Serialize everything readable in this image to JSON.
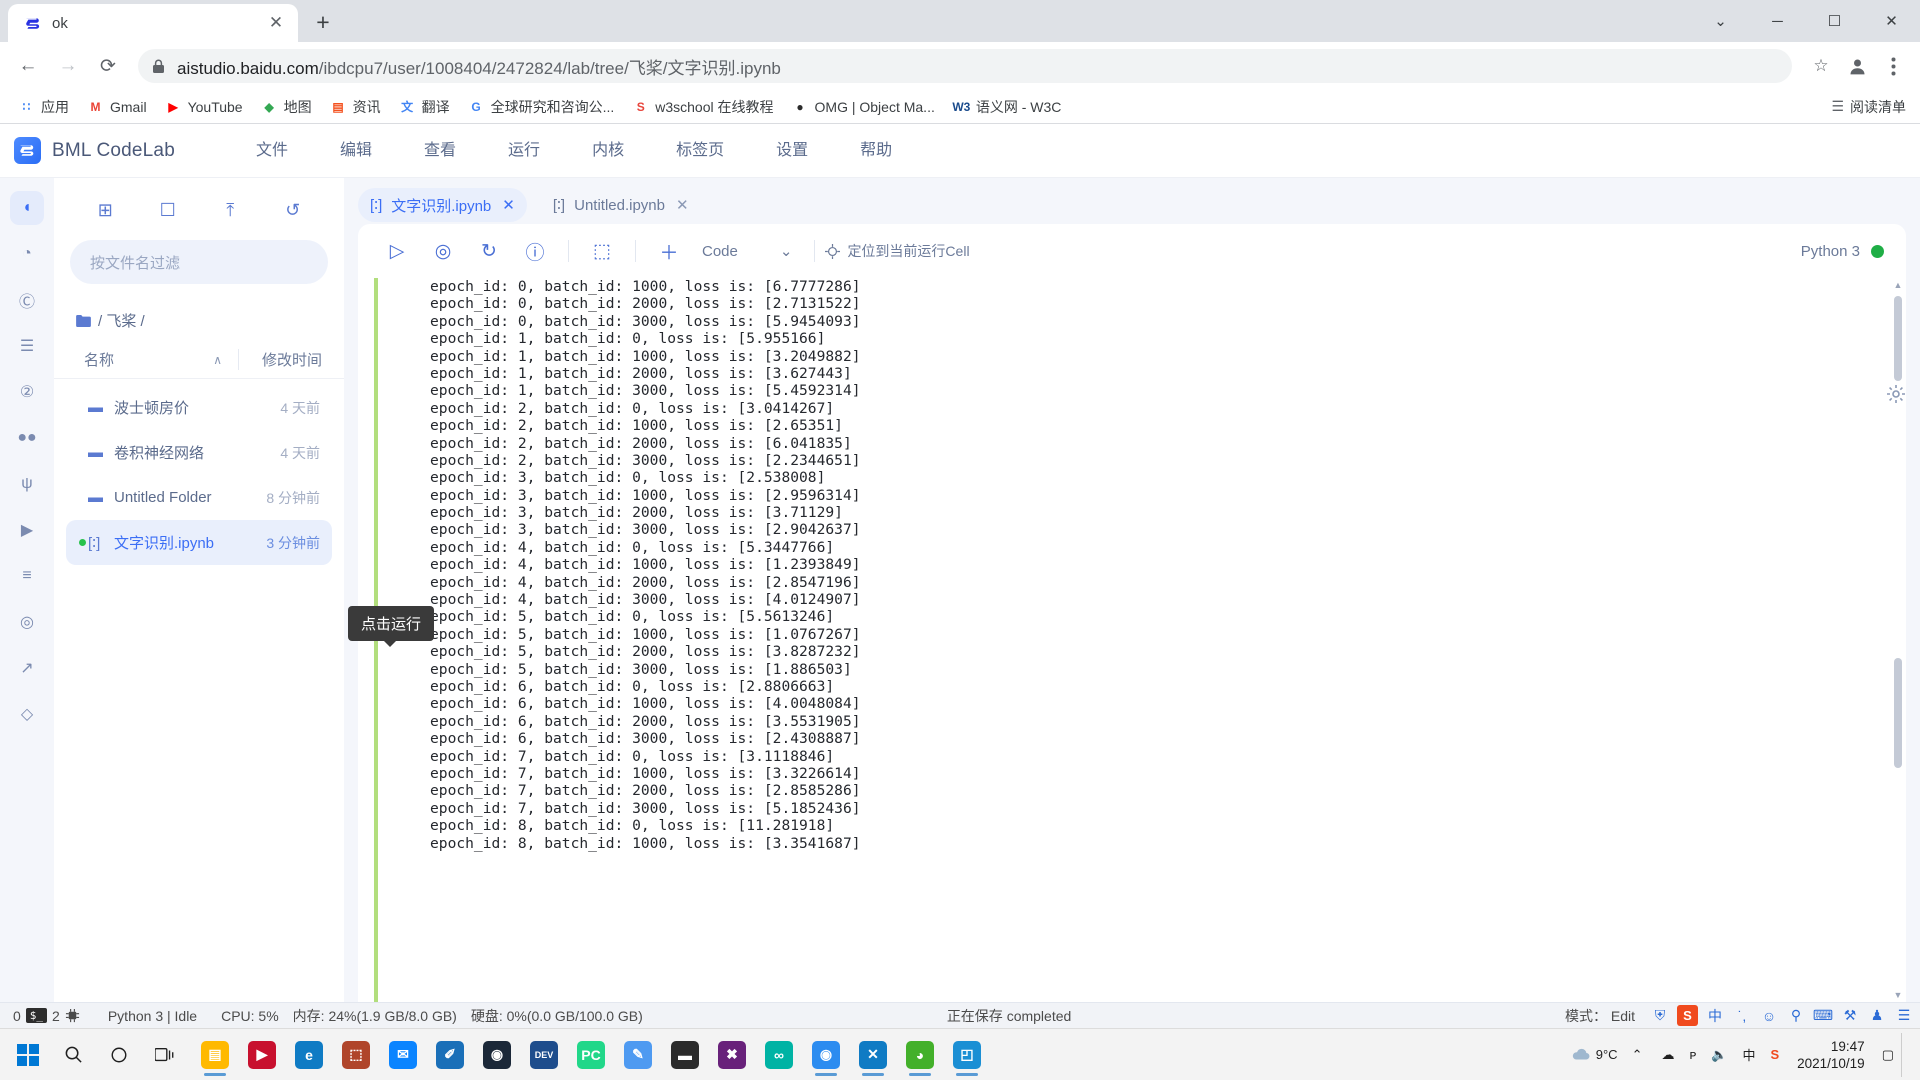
{
  "browser": {
    "tab": {
      "title": "ok",
      "favicon_name": "aistudio-favicon"
    },
    "newtab_label": "+",
    "window_controls": {
      "minimize": "─",
      "maximize": "☐",
      "close": "✕",
      "chevron": "⌄"
    },
    "nav": {
      "back": "←",
      "forward": "→",
      "reload": "⟳"
    },
    "omnibox": {
      "lock_icon": "lock-icon",
      "url_domain": "aistudio.baidu.com",
      "url_path": "/ibdcpu7/user/1008404/2472824/lab/tree/飞桨/文字识别.ipynb",
      "star": "☆"
    },
    "bookmarks": [
      {
        "label": "应用",
        "icon": "apps-grid-icon",
        "color": "#4285f4",
        "glyph": "∷"
      },
      {
        "label": "Gmail",
        "icon": "gmail-icon",
        "color": "#ea4335",
        "glyph": "M"
      },
      {
        "label": "YouTube",
        "icon": "youtube-icon",
        "color": "#ff0000",
        "glyph": "▶"
      },
      {
        "label": "地图",
        "icon": "google-maps-icon",
        "color": "#34a853",
        "glyph": "◆"
      },
      {
        "label": "资讯",
        "icon": "google-news-icon",
        "color": "#f4511e",
        "glyph": "▤"
      },
      {
        "label": "翻译",
        "icon": "google-translate-icon",
        "color": "#4285f4",
        "glyph": "文"
      },
      {
        "label": "全球研究和咨询公...",
        "icon": "google-g-icon",
        "color": "#4285f4",
        "glyph": "G"
      },
      {
        "label": "w3school 在线教程",
        "icon": "w3school-icon",
        "color": "#e8453c",
        "glyph": "S"
      },
      {
        "label": "OMG | Object Ma...",
        "icon": "omg-icon",
        "color": "#2b2b2b",
        "glyph": "●"
      },
      {
        "label": "语义网 - W3C",
        "icon": "w3c-icon",
        "color": "#1a4b8c",
        "glyph": "W3"
      }
    ],
    "reading_list": "阅读清单",
    "reading_list_icon": "reading-list-icon",
    "profile_icon": "profile-avatar-icon",
    "menu_icon": "chrome-menu-icon"
  },
  "bml": {
    "brand": "BML CodeLab",
    "logo_glyph": "ə",
    "menu": [
      "文件",
      "编辑",
      "查看",
      "运行",
      "内核",
      "标签页",
      "设置",
      "帮助"
    ]
  },
  "rail": [
    {
      "name": "files",
      "glyph": "◖",
      "active": true
    },
    {
      "name": "running",
      "glyph": "◔",
      "active": false
    },
    {
      "name": "commands",
      "glyph": "Ⓒ",
      "active": false
    },
    {
      "name": "properties",
      "glyph": "☰",
      "active": false
    },
    {
      "name": "datasets",
      "glyph": "②",
      "active": false
    },
    {
      "name": "extensions",
      "glyph": "●●",
      "active": false
    },
    {
      "name": "git",
      "glyph": "ψ",
      "active": false
    },
    {
      "name": "player",
      "glyph": "▶",
      "active": false
    },
    {
      "name": "notes",
      "glyph": "≡",
      "active": false
    },
    {
      "name": "target",
      "glyph": "◎",
      "active": false
    },
    {
      "name": "analytics",
      "glyph": "↗",
      "active": false
    },
    {
      "name": "diamond",
      "glyph": "◇",
      "active": false
    }
  ],
  "filebrowser": {
    "toolbar": [
      {
        "name": "new-launcher",
        "glyph": "⊞"
      },
      {
        "name": "new-folder",
        "glyph": "☐"
      },
      {
        "name": "upload",
        "glyph": "⤒"
      },
      {
        "name": "refresh",
        "glyph": "↺"
      }
    ],
    "filter_placeholder": "按文件名过滤",
    "breadcrumb": "/ 飞桨 /",
    "breadcrumb_icon": "folder-icon",
    "col_name": "名称",
    "col_modified": "修改时间",
    "sort_arrow": "∧",
    "items": [
      {
        "name": "波士顿房价",
        "time": "4 天前",
        "type": "folder",
        "selected": false,
        "running": false
      },
      {
        "name": "卷积神经网络",
        "time": "4 天前",
        "type": "folder",
        "selected": false,
        "running": false
      },
      {
        "name": "Untitled Folder",
        "time": "8 分钟前",
        "type": "folder",
        "selected": false,
        "running": false
      },
      {
        "name": "文字识别.ipynb",
        "time": "3 分钟前",
        "type": "notebook",
        "selected": true,
        "running": true
      }
    ]
  },
  "notebook": {
    "tabs": [
      {
        "label": "文字识别.ipynb",
        "active": true,
        "close": "✕",
        "icon": "notebook-icon"
      },
      {
        "label": "Untitled.ipynb",
        "active": false,
        "close": "✕",
        "icon": "notebook-icon"
      }
    ],
    "toolbar": {
      "run": {
        "name": "run-cell-button",
        "glyph": "▷"
      },
      "run_all": {
        "name": "run-all-button",
        "glyph": "◎"
      },
      "restart": {
        "name": "restart-kernel-button",
        "glyph": "↻"
      },
      "interrupt": {
        "name": "interrupt-kernel-button",
        "glyph": "ⓘ"
      },
      "save": {
        "name": "save-notebook-button",
        "glyph": "⬚"
      },
      "add": {
        "name": "add-cell-button",
        "glyph": "＋"
      },
      "celltype_value": "Code",
      "celltype_caret": "⌄",
      "locate_label": "定位到当前运行Cell",
      "locate_icon": "crosshair-icon",
      "kernel_label": "Python 3",
      "kernel_status": "idle-dot"
    },
    "tooltip": "点击运行",
    "settings_icon": "settings-gear-icon",
    "output_lines": [
      "epoch_id: 0, batch_id: 1000, loss is: [6.7777286]",
      "epoch_id: 0, batch_id: 2000, loss is: [2.7131522]",
      "epoch_id: 0, batch_id: 3000, loss is: [5.9454093]",
      "epoch_id: 1, batch_id: 0, loss is: [5.955166]",
      "epoch_id: 1, batch_id: 1000, loss is: [3.2049882]",
      "epoch_id: 1, batch_id: 2000, loss is: [3.627443]",
      "epoch_id: 1, batch_id: 3000, loss is: [5.4592314]",
      "epoch_id: 2, batch_id: 0, loss is: [3.0414267]",
      "epoch_id: 2, batch_id: 1000, loss is: [2.65351]",
      "epoch_id: 2, batch_id: 2000, loss is: [6.041835]",
      "epoch_id: 2, batch_id: 3000, loss is: [2.2344651]",
      "epoch_id: 3, batch_id: 0, loss is: [2.538008]",
      "epoch_id: 3, batch_id: 1000, loss is: [2.9596314]",
      "epoch_id: 3, batch_id: 2000, loss is: [3.71129]",
      "epoch_id: 3, batch_id: 3000, loss is: [2.9042637]",
      "epoch_id: 4, batch_id: 0, loss is: [5.3447766]",
      "epoch_id: 4, batch_id: 1000, loss is: [1.2393849]",
      "epoch_id: 4, batch_id: 2000, loss is: [2.8547196]",
      "epoch_id: 4, batch_id: 3000, loss is: [4.0124907]",
      "epoch_id: 5, batch_id: 0, loss is: [5.5613246]",
      "epoch_id: 5, batch_id: 1000, loss is: [1.0767267]",
      "epoch_id: 5, batch_id: 2000, loss is: [3.8287232]",
      "epoch_id: 5, batch_id: 3000, loss is: [1.886503]",
      "epoch_id: 6, batch_id: 0, loss is: [2.8806663]",
      "epoch_id: 6, batch_id: 1000, loss is: [4.0048084]",
      "epoch_id: 6, batch_id: 2000, loss is: [3.5531905]",
      "epoch_id: 6, batch_id: 3000, loss is: [2.4308887]",
      "epoch_id: 7, batch_id: 0, loss is: [3.1118846]",
      "epoch_id: 7, batch_id: 1000, loss is: [3.3226614]",
      "epoch_id: 7, batch_id: 2000, loss is: [2.8585286]",
      "epoch_id: 7, batch_id: 3000, loss is: [5.1852436]",
      "epoch_id: 8, batch_id: 0, loss is: [11.281918]",
      "epoch_id: 8, batch_id: 1000, loss is: [3.3541687]"
    ]
  },
  "statusbar": {
    "terminals_count": "0",
    "terminal_icon": "terminal-icon",
    "kernels_count": "2",
    "cpu_icon": "cpu-chip-icon",
    "kernel_state": "Python 3 | Idle",
    "cpu": "CPU: 5%",
    "memory": "内存: 24%(1.9 GB/8.0 GB)",
    "disk": "硬盘: 0%(0.0 GB/100.0 GB)",
    "save_state": "正在保存 completed",
    "mode": "模式： Edit",
    "ime": [
      {
        "name": "shield-icon",
        "glyph": "⛨"
      },
      {
        "name": "sogou-logo-icon",
        "glyph": "S"
      },
      {
        "name": "chinese-mode-icon",
        "glyph": "中"
      },
      {
        "name": "punctuation-icon",
        "glyph": "˙,"
      },
      {
        "name": "emoji-icon",
        "glyph": "☺"
      },
      {
        "name": "voice-input-icon",
        "glyph": "⚲"
      },
      {
        "name": "soft-keyboard-icon",
        "glyph": "⌨"
      },
      {
        "name": "toolbox-icon",
        "glyph": "⚒"
      },
      {
        "name": "skin-icon",
        "glyph": "♟"
      },
      {
        "name": "more-apps-icon",
        "glyph": "☰"
      }
    ]
  },
  "taskbar": {
    "start_name": "start-button",
    "search_glyph": "⌕",
    "cortana_glyph": "◯",
    "taskview_glyph": "▤",
    "apps": [
      {
        "name": "file-explorer",
        "glyph": "▤",
        "color": "#ffb900",
        "running": true
      },
      {
        "name": "media-player",
        "glyph": "▶",
        "color": "#c8102e",
        "running": false
      },
      {
        "name": "microsoft-edge",
        "glyph": "e",
        "color": "#0f7bc4",
        "running": false
      },
      {
        "name": "store",
        "glyph": "⬚",
        "color": "#b0452a",
        "running": false
      },
      {
        "name": "mail",
        "glyph": "✉",
        "color": "#0a84ff",
        "running": false
      },
      {
        "name": "editor",
        "glyph": "✐",
        "color": "#1a6fb8",
        "running": false
      },
      {
        "name": "steam",
        "glyph": "◉",
        "color": "#1b2838",
        "running": false
      },
      {
        "name": "dev-tool",
        "glyph": "DEV",
        "color": "#1e4d8c",
        "running": false
      },
      {
        "name": "pycharm",
        "glyph": "PC",
        "color": "#21d789",
        "running": false
      },
      {
        "name": "draw-app",
        "glyph": "✎",
        "color": "#4e9af1",
        "running": false
      },
      {
        "name": "notes-app",
        "glyph": "▬",
        "color": "#2b2b2b",
        "running": false
      },
      {
        "name": "visual-studio",
        "glyph": "✖",
        "color": "#68217a",
        "running": false
      },
      {
        "name": "link-app",
        "glyph": "∞",
        "color": "#00b3a4",
        "running": false
      },
      {
        "name": "google-chrome",
        "glyph": "◉",
        "color": "#2c8cf0",
        "running": true
      },
      {
        "name": "vscode",
        "glyph": "✕",
        "color": "#0f7bc4",
        "running": true
      },
      {
        "name": "anaconda",
        "glyph": "◕",
        "color": "#43b02a",
        "running": true
      },
      {
        "name": "photos",
        "glyph": "◰",
        "color": "#1b8fd4",
        "running": true
      }
    ],
    "weather_icon": "cloud-icon",
    "weather": "9°C",
    "tray_chevron": "⌃",
    "tray": [
      {
        "name": "onedrive-icon",
        "glyph": "☁"
      },
      {
        "name": "network-icon",
        "glyph": "ᴘ"
      },
      {
        "name": "volume-icon",
        "glyph": "🔈"
      },
      {
        "name": "ime-tray-icon",
        "glyph": "中"
      },
      {
        "name": "sogou-tray-icon",
        "glyph": "S"
      }
    ],
    "time": "19:47",
    "date": "2021/10/19",
    "notification_glyph": "▢"
  }
}
